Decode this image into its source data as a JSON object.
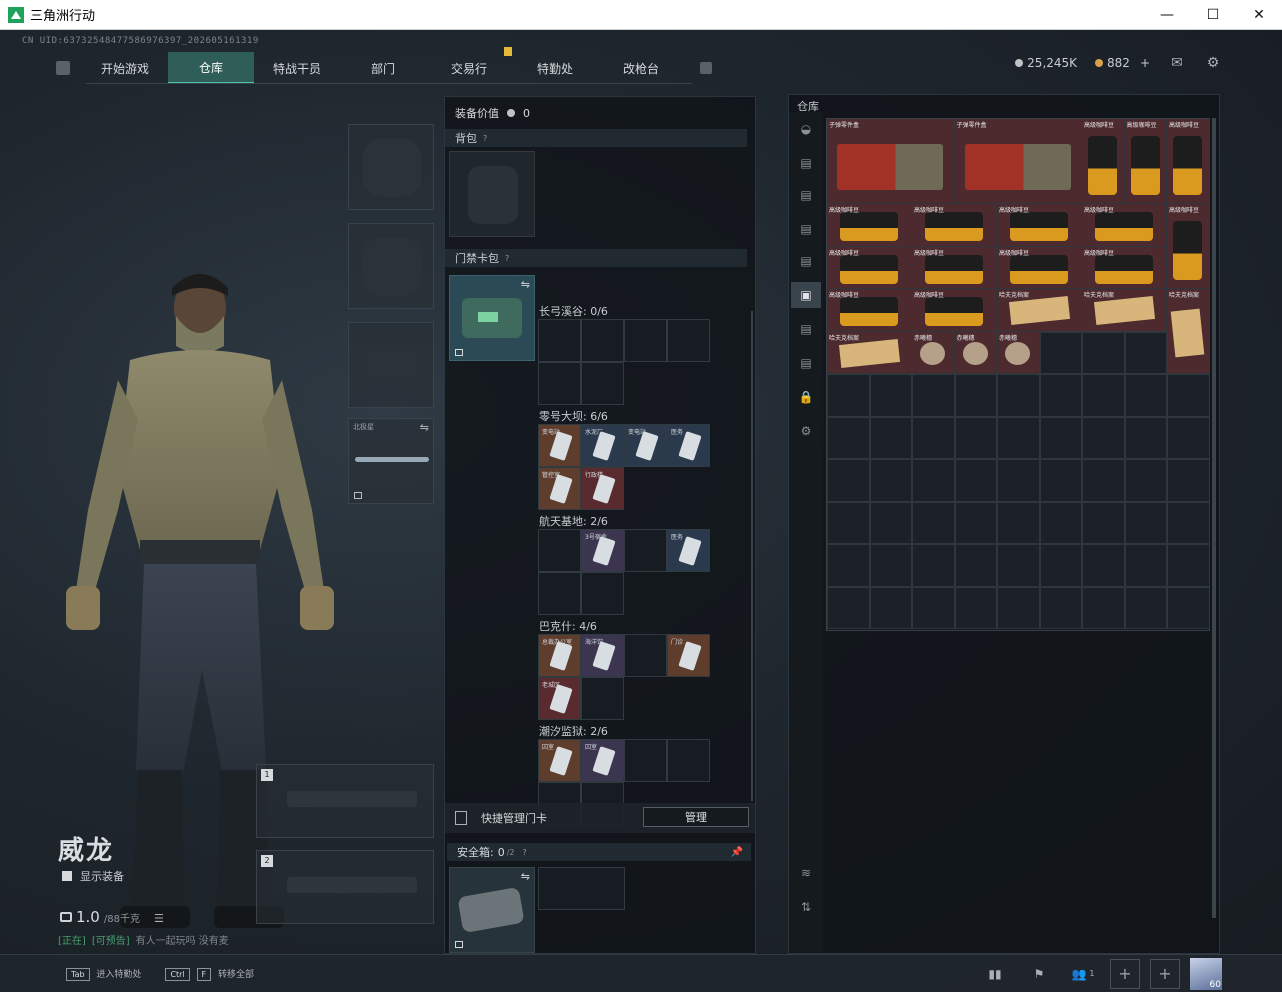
{
  "window": {
    "title": "三角洲行动",
    "controls": {
      "minimize": "—",
      "maximize": "☐",
      "close": "✕"
    }
  },
  "uid": "CN UID:637325484775869763​97_202605161319",
  "nav": {
    "tabs": [
      {
        "label": "开始游戏",
        "active": false
      },
      {
        "label": "仓库",
        "active": true
      },
      {
        "label": "特战干员",
        "active": false
      },
      {
        "label": "部门",
        "active": false
      },
      {
        "label": "交易行",
        "active": false
      },
      {
        "label": "特勤处",
        "active": false
      },
      {
        "label": "改枪台",
        "active": false
      }
    ]
  },
  "currency": {
    "silver": "25,245K",
    "gold": "882",
    "gold_add": "+",
    "icons": [
      "mail-icon",
      "gear-icon"
    ]
  },
  "character": {
    "name": "威龙",
    "show_equipment": "显示装备",
    "weight": "1.0",
    "weight_unit": "/88千克",
    "status_tag1": "[正在]",
    "status_tag2": "[可预告]",
    "status_text": "有人一起玩吗 没有麦",
    "melee_label": "北极星",
    "weapon_slots": [
      "1",
      "2"
    ]
  },
  "loadout": {
    "equip_value_label": "装备价值",
    "equip_value": "0",
    "backpack_label": "背包",
    "keycard_case_label": "门禁卡包",
    "zones": [
      {
        "title": "长弓溪谷: 0/6",
        "rows": [
          [
            {
              "k": "cell"
            },
            {
              "k": "cell"
            },
            {
              "k": "cell"
            },
            {
              "k": "cell"
            }
          ],
          [
            {
              "k": "cell"
            },
            {
              "k": "cell"
            },
            {
              "k": "empty"
            },
            {
              "k": "empty"
            }
          ]
        ]
      },
      {
        "title": "零号大坝: 6/6",
        "rows": [
          [
            {
              "k": "item",
              "c": "orange",
              "l": "变电站"
            },
            {
              "k": "item",
              "c": "blue",
              "l": "水泥厂"
            },
            {
              "k": "item",
              "c": "blue",
              "l": "变电站"
            },
            {
              "k": "item",
              "c": "blue",
              "l": "医务"
            }
          ],
          [
            {
              "k": "item",
              "c": "orange",
              "l": "管控室"
            },
            {
              "k": "item",
              "c": "red",
              "l": "行政楼"
            },
            {
              "k": "empty"
            },
            {
              "k": "empty"
            }
          ]
        ]
      },
      {
        "title": "航天基地: 2/6",
        "rows": [
          [
            {
              "k": "cell"
            },
            {
              "k": "item",
              "c": "purple",
              "l": "3号宿舍"
            },
            {
              "k": "cell"
            },
            {
              "k": "item",
              "c": "blue",
              "l": "医务"
            }
          ],
          [
            {
              "k": "cell"
            },
            {
              "k": "cell"
            },
            {
              "k": "empty"
            },
            {
              "k": "empty"
            }
          ]
        ]
      },
      {
        "title": "巴克什: 4/6",
        "rows": [
          [
            {
              "k": "item",
              "c": "orange",
              "l": "总裁办公室"
            },
            {
              "k": "item",
              "c": "purple",
              "l": "海洋馆"
            },
            {
              "k": "cell"
            },
            {
              "k": "item",
              "c": "orange",
              "l": "门诊"
            }
          ],
          [
            {
              "k": "item",
              "c": "red",
              "l": "老城区"
            },
            {
              "k": "cell"
            },
            {
              "k": "empty"
            },
            {
              "k": "empty"
            }
          ]
        ]
      },
      {
        "title": "潮汐监狱: 2/6",
        "rows": [
          [
            {
              "k": "item",
              "c": "orange",
              "l": "囚室"
            },
            {
              "k": "item",
              "c": "purple",
              "l": "囚室"
            },
            {
              "k": "cell"
            },
            {
              "k": "cell"
            }
          ],
          [
            {
              "k": "cell"
            },
            {
              "k": "cell"
            },
            {
              "k": "empty"
            },
            {
              "k": "empty"
            }
          ]
        ]
      }
    ],
    "quick_manage": "快捷管理门卡",
    "manage_button": "管理",
    "safe_box_label": "安全箱:",
    "safe_box_count": "0",
    "safe_box_max": "/2"
  },
  "warehouse": {
    "title": "仓库",
    "items": [
      {
        "type": "crate",
        "label": "子弹零件盒",
        "col": 0,
        "row": 0,
        "w": 3,
        "h": 2
      },
      {
        "type": "crate",
        "label": "子弹零件盒",
        "col": 3,
        "row": 0,
        "w": 3,
        "h": 2
      },
      {
        "type": "coffee",
        "label": "高级咖啡豆",
        "col": 6,
        "row": 0,
        "w": 1,
        "h": 2
      },
      {
        "type": "coffee",
        "label": "高级咖啡豆",
        "col": 7,
        "row": 0,
        "w": 1,
        "h": 2
      },
      {
        "type": "coffee",
        "label": "高级咖啡豆",
        "col": 8,
        "row": 0,
        "w": 1,
        "h": 2
      },
      {
        "type": "coffee",
        "label": "高级咖啡豆",
        "col": 0,
        "row": 2,
        "w": 2,
        "h": 1
      },
      {
        "type": "coffee",
        "label": "高级咖啡豆",
        "col": 2,
        "row": 2,
        "w": 2,
        "h": 1
      },
      {
        "type": "coffee",
        "label": "高级咖啡豆",
        "col": 4,
        "row": 2,
        "w": 2,
        "h": 1
      },
      {
        "type": "coffee",
        "label": "高级咖啡豆",
        "col": 6,
        "row": 2,
        "w": 2,
        "h": 1
      },
      {
        "type": "coffee",
        "label": "高级咖啡豆",
        "col": 8,
        "row": 2,
        "w": 1,
        "h": 2
      },
      {
        "type": "coffee",
        "label": "高级咖啡豆",
        "col": 0,
        "row": 3,
        "w": 2,
        "h": 1
      },
      {
        "type": "coffee",
        "label": "高级咖啡豆",
        "col": 2,
        "row": 3,
        "w": 2,
        "h": 1
      },
      {
        "type": "coffee",
        "label": "高级咖啡豆",
        "col": 4,
        "row": 3,
        "w": 2,
        "h": 1
      },
      {
        "type": "coffee",
        "label": "高级咖啡豆",
        "col": 6,
        "row": 3,
        "w": 2,
        "h": 1
      },
      {
        "type": "coffee",
        "label": "高级咖啡豆",
        "col": 0,
        "row": 4,
        "w": 2,
        "h": 1
      },
      {
        "type": "coffee",
        "label": "高级咖啡豆",
        "col": 2,
        "row": 4,
        "w": 2,
        "h": 1
      },
      {
        "type": "paper",
        "label": "哈夫克档案",
        "col": 4,
        "row": 4,
        "w": 2,
        "h": 1
      },
      {
        "type": "paper",
        "label": "哈夫克档案",
        "col": 6,
        "row": 4,
        "w": 2,
        "h": 1
      },
      {
        "type": "paper",
        "label": "哈夫克档案",
        "col": 8,
        "row": 4,
        "w": 1,
        "h": 2
      },
      {
        "type": "paper",
        "label": "哈夫克档案",
        "col": 0,
        "row": 5,
        "w": 2,
        "h": 1
      },
      {
        "type": "small",
        "label": "赤曦穗",
        "col": 2,
        "row": 5,
        "w": 1,
        "h": 1
      },
      {
        "type": "small",
        "label": "赤曦穗",
        "col": 3,
        "row": 5,
        "w": 1,
        "h": 1
      },
      {
        "type": "small",
        "label": "赤曦穗",
        "col": 4,
        "row": 5,
        "w": 1,
        "h": 1
      }
    ]
  },
  "bottombar": {
    "tab_key": "Tab",
    "tab_action": "进入特勤处",
    "ctrl_key": "Ctrl",
    "f_key": "F",
    "ctrl_action": "转移全部",
    "friends_count": "1",
    "avatar_level": "60"
  }
}
